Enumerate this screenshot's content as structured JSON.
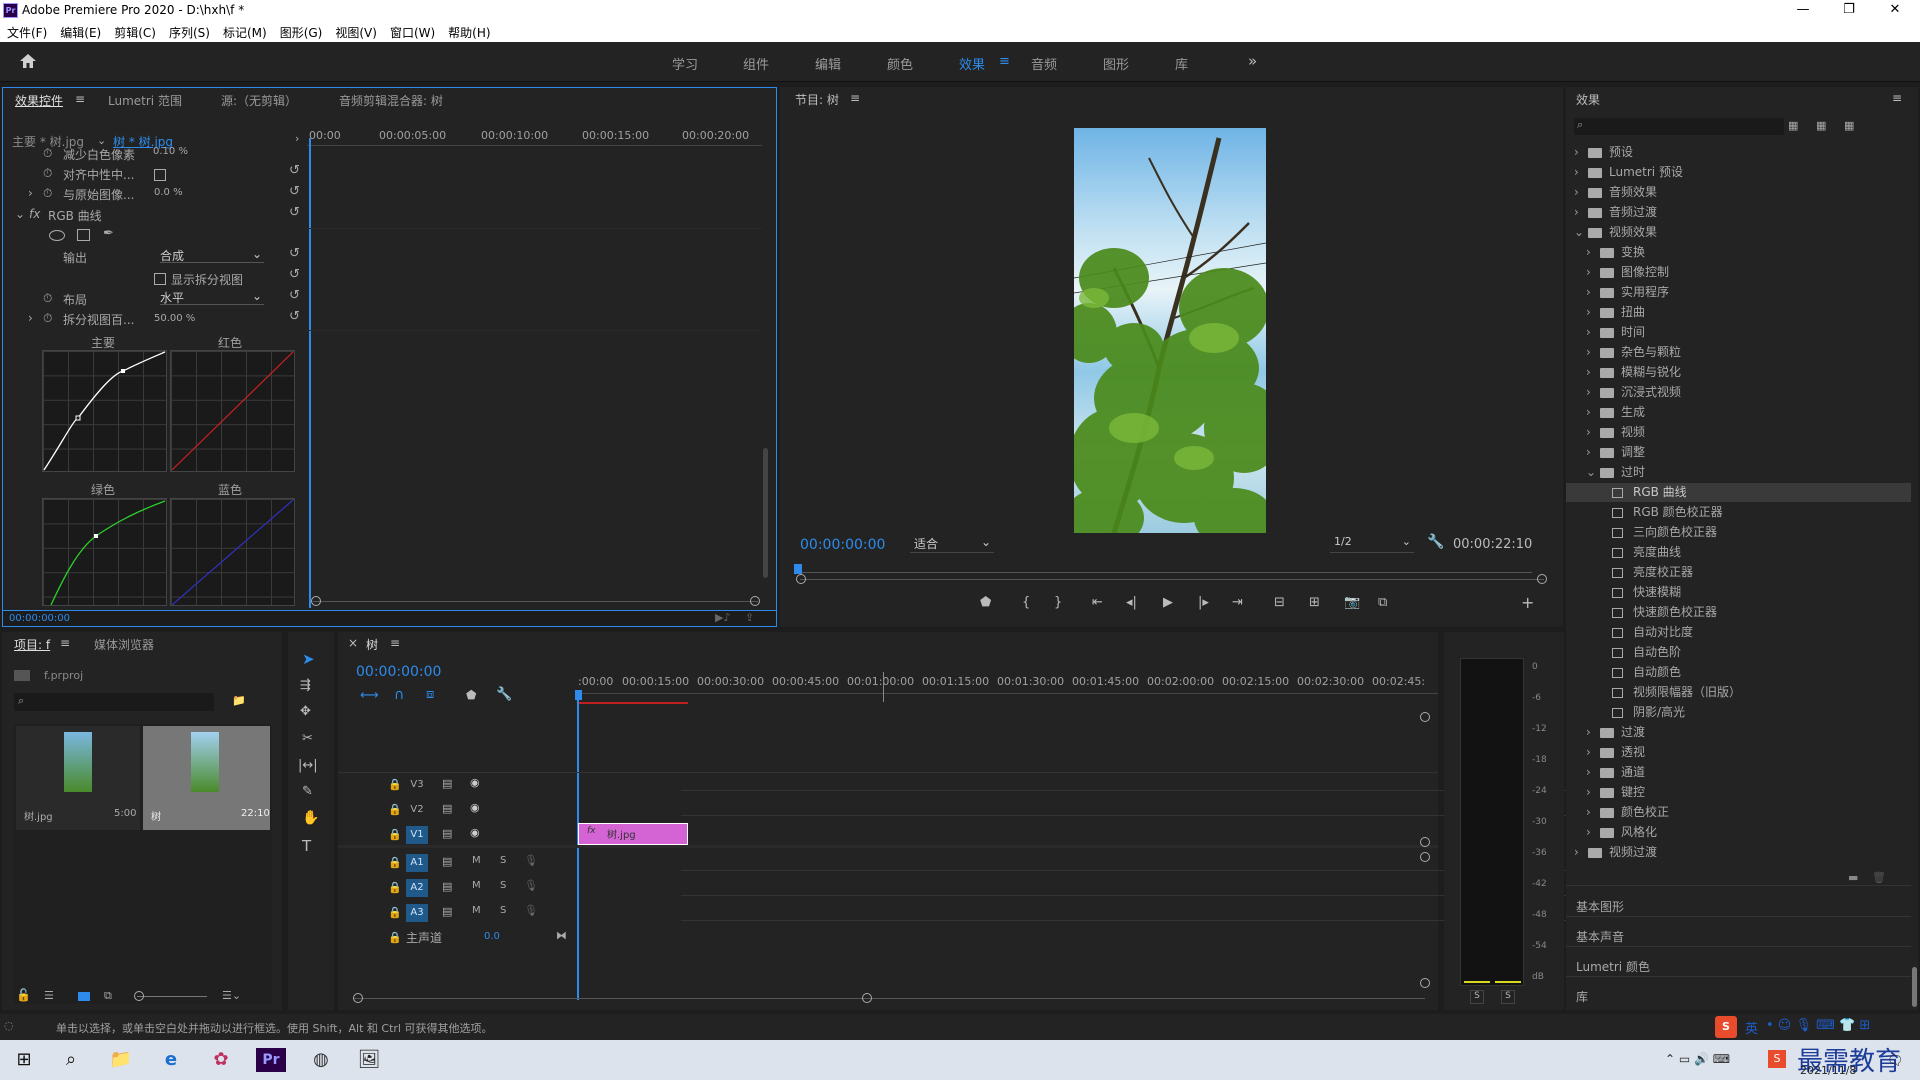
{
  "app": {
    "title": "Adobe Premiere Pro 2020 - D:\\hxh\\f *",
    "icon": "Pr"
  },
  "menu": [
    "文件(F)",
    "编辑(E)",
    "剪辑(C)",
    "序列(S)",
    "标记(M)",
    "图形(G)",
    "视图(V)",
    "窗口(W)",
    "帮助(H)"
  ],
  "workspaces": [
    "学习",
    "组件",
    "编辑",
    "颜色",
    "效果",
    "音频",
    "图形",
    "库"
  ],
  "active_workspace": "效果",
  "effect_controls": {
    "tabs": [
      "效果控件",
      "Lumetri 范围",
      "源:（无剪辑）",
      "音频剪辑混合器: 树"
    ],
    "clip_main": "主要 * 树.jpg",
    "clip_seq": "树 * 树.jpg",
    "ruler": [
      "00:00",
      "00:00:05:00",
      "00:00:10:00",
      "00:00:15:00",
      "00:00:20:00"
    ],
    "rows": [
      {
        "label": "减少白色像素",
        "value": "0.10 %"
      },
      {
        "label": "对齐中性中...",
        "value": ""
      },
      {
        "label": "与原始图像...",
        "value": "0.0 %"
      },
      {
        "label": "RGB 曲线",
        "value": ""
      },
      {
        "label": "输出",
        "value": "合成"
      },
      {
        "label": "显示拆分视图",
        "value": ""
      },
      {
        "label": "布局",
        "value": "水平"
      },
      {
        "label": "拆分视图百...",
        "value": "50.00 %"
      }
    ],
    "curves": [
      "主要",
      "红色",
      "绿色",
      "蓝色"
    ],
    "timecode": "00:00:00:00"
  },
  "program": {
    "title": "节目: 树",
    "timecode": "00:00:00:00",
    "fit": "适合",
    "quality": "1/2",
    "duration": "00:00:22:10"
  },
  "project": {
    "tabs": [
      "项目: f",
      "媒体浏览器"
    ],
    "file": "f.prproj",
    "items": [
      {
        "name": "树.jpg",
        "duration": "5:00"
      },
      {
        "name": "树",
        "duration": "22:10"
      }
    ]
  },
  "timeline": {
    "tab": "树",
    "timecode": "00:00:00:00",
    "ruler": [
      ":00:00",
      "00:00:15:00",
      "00:00:30:00",
      "00:00:45:00",
      "00:01:00:00",
      "00:01:15:00",
      "00:01:30:00",
      "00:01:45:00",
      "00:02:00:00",
      "00:02:15:00",
      "00:02:30:00",
      "00:02:45:"
    ],
    "video_tracks": [
      "V3",
      "V2",
      "V1"
    ],
    "audio_tracks": [
      "A1",
      "A2",
      "A3"
    ],
    "master": "主声道",
    "master_val": "0.0",
    "clip": "树.jpg"
  },
  "meter": {
    "scale": [
      "0",
      "-6",
      "-12",
      "-18",
      "-24",
      "-30",
      "-36",
      "-42",
      "-48",
      "-54",
      "dB"
    ],
    "solo": [
      "S",
      "S"
    ]
  },
  "effects": {
    "title": "效果",
    "tree": [
      {
        "label": "预设",
        "level": 0,
        "type": "folder"
      },
      {
        "label": "Lumetri 预设",
        "level": 0,
        "type": "folder"
      },
      {
        "label": "音频效果",
        "level": 0,
        "type": "folder"
      },
      {
        "label": "音频过渡",
        "level": 0,
        "type": "folder"
      },
      {
        "label": "视频效果",
        "level": 0,
        "type": "folder",
        "open": true
      },
      {
        "label": "变换",
        "level": 1,
        "type": "folder"
      },
      {
        "label": "图像控制",
        "level": 1,
        "type": "folder"
      },
      {
        "label": "实用程序",
        "level": 1,
        "type": "folder"
      },
      {
        "label": "扭曲",
        "level": 1,
        "type": "folder"
      },
      {
        "label": "时间",
        "level": 1,
        "type": "folder"
      },
      {
        "label": "杂色与颗粒",
        "level": 1,
        "type": "folder"
      },
      {
        "label": "模糊与锐化",
        "level": 1,
        "type": "folder"
      },
      {
        "label": "沉浸式视频",
        "level": 1,
        "type": "folder"
      },
      {
        "label": "生成",
        "level": 1,
        "type": "folder"
      },
      {
        "label": "视频",
        "level": 1,
        "type": "folder"
      },
      {
        "label": "调整",
        "level": 1,
        "type": "folder"
      },
      {
        "label": "过时",
        "level": 1,
        "type": "folder",
        "open": true
      },
      {
        "label": "RGB 曲线",
        "level": 2,
        "type": "fx",
        "selected": true
      },
      {
        "label": "RGB 颜色校正器",
        "level": 2,
        "type": "fx"
      },
      {
        "label": "三向颜色校正器",
        "level": 2,
        "type": "fx"
      },
      {
        "label": "亮度曲线",
        "level": 2,
        "type": "fx"
      },
      {
        "label": "亮度校正器",
        "level": 2,
        "type": "fx"
      },
      {
        "label": "快速模糊",
        "level": 2,
        "type": "fx"
      },
      {
        "label": "快速颜色校正器",
        "level": 2,
        "type": "fx"
      },
      {
        "label": "自动对比度",
        "level": 2,
        "type": "fx"
      },
      {
        "label": "自动色阶",
        "level": 2,
        "type": "fx"
      },
      {
        "label": "自动颜色",
        "level": 2,
        "type": "fx"
      },
      {
        "label": "视频限幅器（旧版）",
        "level": 2,
        "type": "fx"
      },
      {
        "label": "阴影/高光",
        "level": 2,
        "type": "fx"
      },
      {
        "label": "过渡",
        "level": 1,
        "type": "folder"
      },
      {
        "label": "透视",
        "level": 1,
        "type": "folder"
      },
      {
        "label": "通道",
        "level": 1,
        "type": "folder"
      },
      {
        "label": "键控",
        "level": 1,
        "type": "folder"
      },
      {
        "label": "颜色校正",
        "level": 1,
        "type": "folder"
      },
      {
        "label": "风格化",
        "level": 1,
        "type": "folder"
      },
      {
        "label": "视频过渡",
        "level": 0,
        "type": "folder"
      }
    ],
    "sections": [
      "基本图形",
      "基本声音",
      "Lumetri 颜色",
      "库"
    ]
  },
  "status": "单击以选择，或单击空白处并拖动以进行框选。使用 Shift，Alt 和 Ctrl 可获得其他选项。",
  "taskbar": {
    "date": "2021/11/8",
    "ime": "英",
    "watermark": "最需教育"
  }
}
